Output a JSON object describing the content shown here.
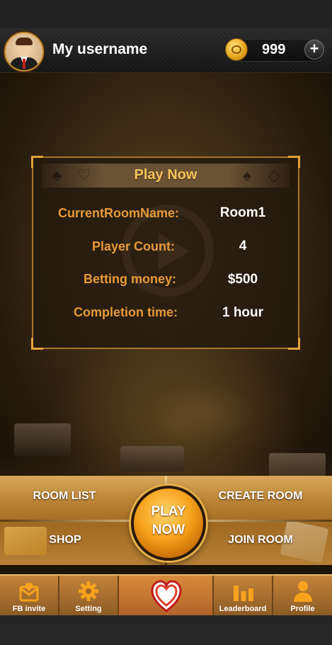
{
  "header": {
    "username": "My username",
    "coins": "999",
    "add_label": "+"
  },
  "dialog": {
    "title": "Play Now",
    "rows": [
      {
        "label": "CurrentRoomName:",
        "value": "Room1"
      },
      {
        "label": "Player Count:",
        "value": "4"
      },
      {
        "label": "Betting money:",
        "value": "$500"
      },
      {
        "label": "Completion time:",
        "value": "1 hour"
      }
    ]
  },
  "menu": {
    "room_list": "ROOM LIST",
    "create_room": "CREATE ROOM",
    "shop": "SHOP",
    "join_room": "JOIN ROOM",
    "play_now_line1": "PLAY",
    "play_now_line2": "NOW"
  },
  "bottom_nav": {
    "items": [
      {
        "label": "FB invite",
        "icon": "heart-envelope-icon"
      },
      {
        "label": "Setting",
        "icon": "gear-icon"
      },
      {
        "label": "",
        "icon": "heart-icon",
        "active": true
      },
      {
        "label": "Leaderboard",
        "icon": "bar-chart-icon"
      },
      {
        "label": "Profile",
        "icon": "person-icon"
      }
    ]
  },
  "colors": {
    "accent": "#e79a3a",
    "title_gold": "#f4c45b",
    "nav_icon": "#f6a21c",
    "active_tab": "#d88a3c"
  }
}
